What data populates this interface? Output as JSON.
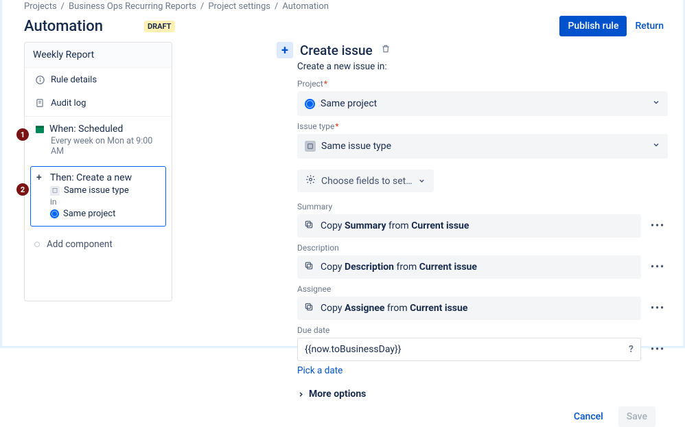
{
  "breadcrumbs": [
    "Projects",
    "Business Ops Recurring Reports",
    "Project settings",
    "Automation"
  ],
  "title": "Automation",
  "badge": "DRAFT",
  "actions": {
    "publish": "Publish rule",
    "return": "Return"
  },
  "sidebar": {
    "name": "Weekly Report",
    "rule_details": "Rule details",
    "audit_log": "Audit log",
    "trigger": {
      "title": "When: Scheduled",
      "sub": "Every week on Mon at 9:00 AM"
    },
    "action": {
      "title": "Then: Create a new",
      "issue_type": "Same issue type",
      "in": "in",
      "project": "Same project"
    },
    "add_component": "Add component"
  },
  "panel": {
    "heading": "Create issue",
    "intro": "Create a new issue in:",
    "project": {
      "label": "Project",
      "value": "Same project"
    },
    "issue_type": {
      "label": "Issue type",
      "value": "Same issue type"
    },
    "choose_fields": "Choose fields to set…",
    "fields": [
      {
        "label": "Summary",
        "prefix": "Copy ",
        "field": "Summary",
        "mid": " from ",
        "src": "Current issue"
      },
      {
        "label": "Description",
        "prefix": "Copy ",
        "field": "Description",
        "mid": " from ",
        "src": "Current issue"
      },
      {
        "label": "Assignee",
        "prefix": "Copy ",
        "field": "Assignee",
        "mid": " from ",
        "src": "Current issue"
      }
    ],
    "due": {
      "label": "Due date",
      "value": "{{now.toBusinessDay}}",
      "pick": "Pick a date"
    },
    "more": "More options"
  },
  "footer": {
    "cancel": "Cancel",
    "save": "Save"
  }
}
